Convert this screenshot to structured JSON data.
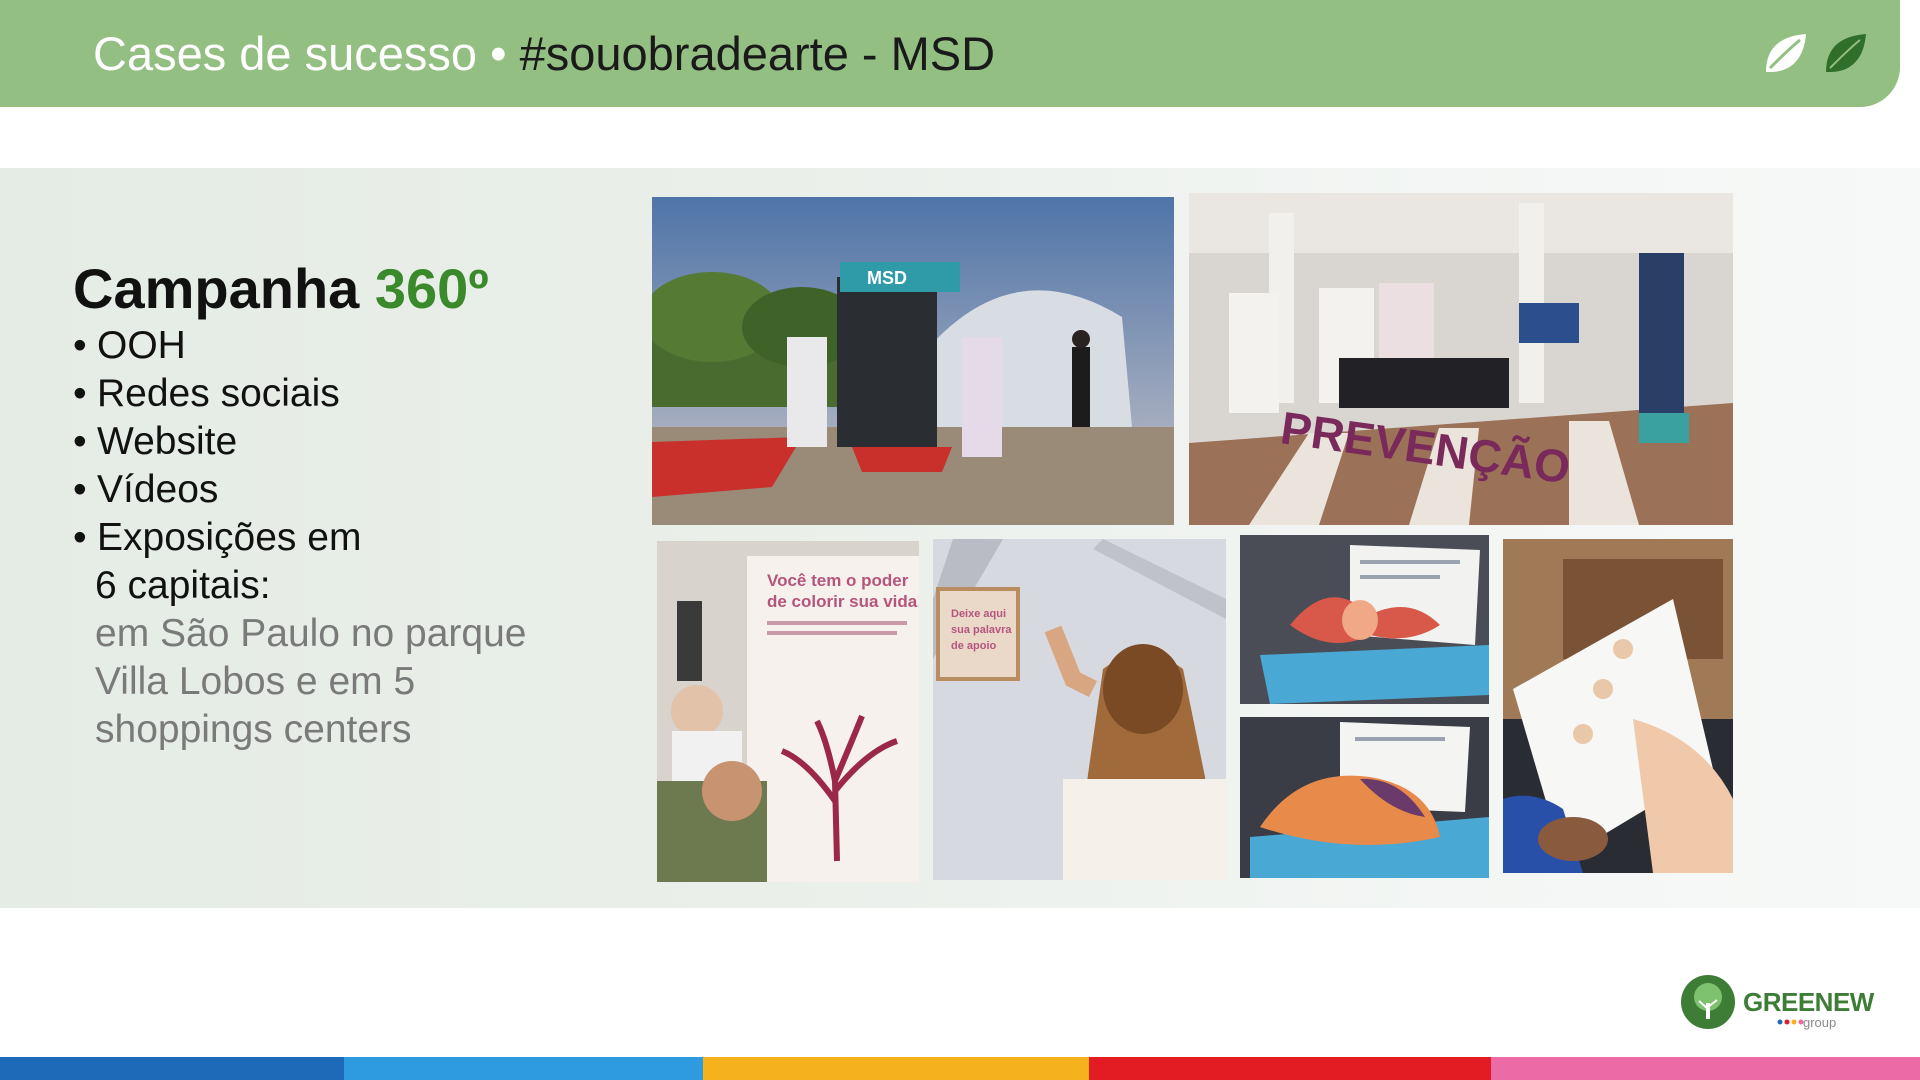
{
  "header": {
    "title_light": "Cases de sucesso • ",
    "title_dark": "#souobradearte - MSD"
  },
  "campaign": {
    "heading_dark": "Campanha ",
    "heading_green": "360º",
    "bullets": [
      "OOH",
      "Redes sociais",
      "Website",
      "Vídeos",
      "Exposições em"
    ],
    "sub_line": "6 capitais:",
    "gray_lines": [
      "em São Paulo no parque",
      "Villa Lobos e em 5",
      "shoppings centers"
    ]
  },
  "photos": {
    "tent_sign": "MSD",
    "mall_sign": "PREVENÇÃO",
    "tree_poster_heading": [
      "Você tem o poder",
      "de colorir sua vida!"
    ],
    "board_sign": [
      "Deixe aqui",
      "sua palavra",
      "de apoio"
    ]
  },
  "logo": {
    "name": "GREENEW",
    "sub": "group"
  },
  "colors": {
    "header_green": "#93bf82",
    "accent_green": "#3a8a2c",
    "bar": [
      "#1e6ab8",
      "#2e9be0",
      "#f5b21c",
      "#e31c24",
      "#ec6aa6"
    ]
  }
}
